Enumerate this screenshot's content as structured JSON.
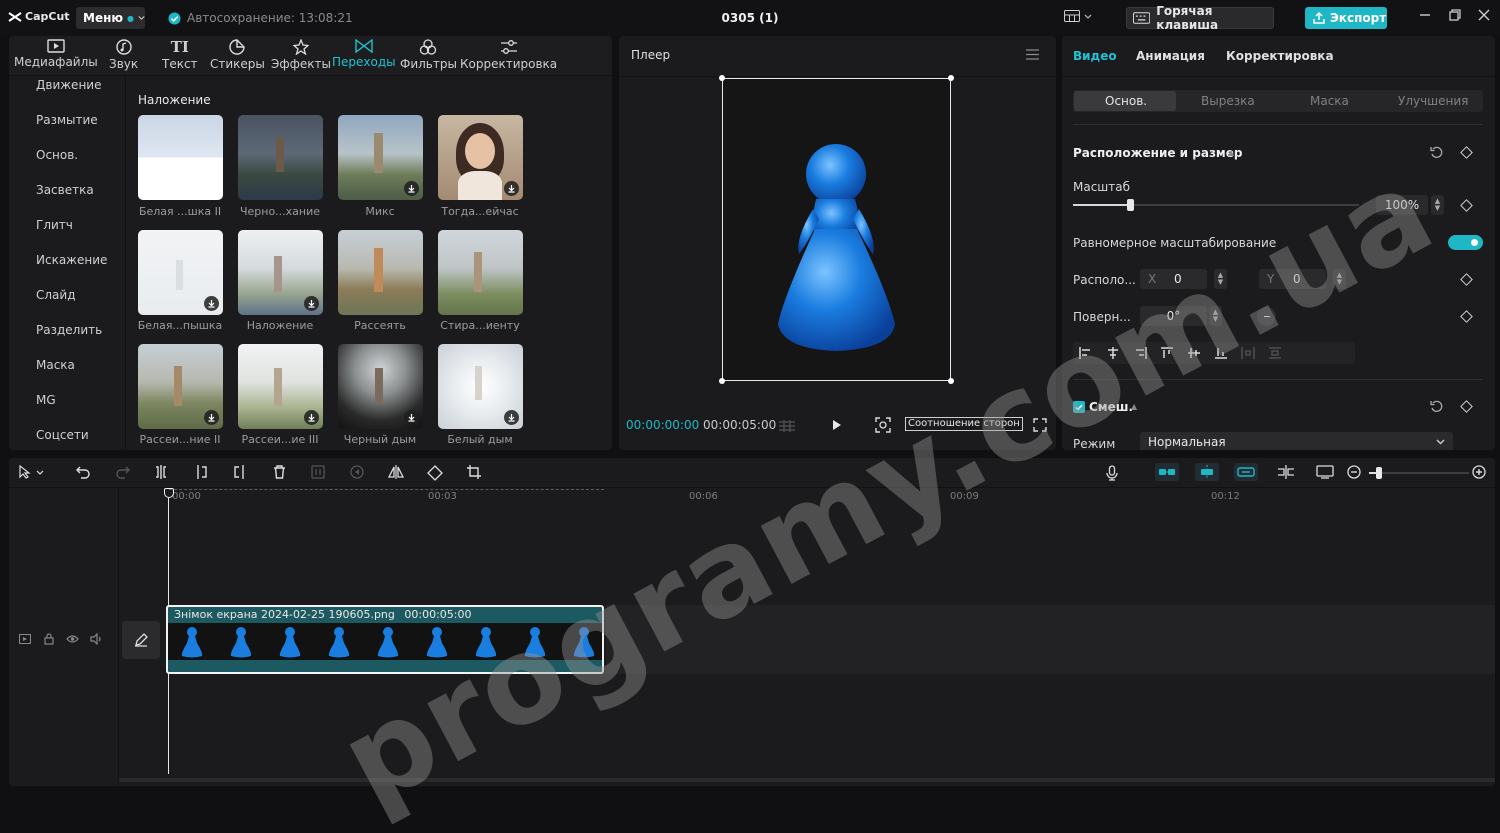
{
  "app": {
    "logo_text": "CapCut",
    "menu_label": "Меню",
    "autosave_text": "Автосохранение: 13:08:21",
    "project_title": "0305 (1)",
    "hotkey_label": "Горячая клавиша",
    "export_label": "Экспорт"
  },
  "media_toolbar": [
    {
      "label": "Медиафайлы",
      "icon": "media-icon"
    },
    {
      "label": "Звук",
      "icon": "audio-icon"
    },
    {
      "label": "Текст",
      "icon": "text-icon"
    },
    {
      "label": "Стикеры",
      "icon": "sticker-icon"
    },
    {
      "label": "Эффекты",
      "icon": "effects-icon"
    },
    {
      "label": "Переходы",
      "icon": "transitions-icon",
      "active": true
    },
    {
      "label": "Фильтры",
      "icon": "filters-icon"
    },
    {
      "label": "Корректировка",
      "icon": "adjust-icon"
    }
  ],
  "sidebar": [
    "Движение",
    "Размытие",
    "Основ.",
    "Засветка",
    "Глитч",
    "Искажение",
    "Слайд",
    "Разделить",
    "Маска",
    "MG",
    "Соцсети"
  ],
  "section_title": "Наложение",
  "transitions": [
    {
      "label": "Белая ...шка II",
      "download": false
    },
    {
      "label": "Черно...хание",
      "download": false
    },
    {
      "label": "Микс",
      "download": true
    },
    {
      "label": "Тогда...ейчас",
      "download": true
    },
    {
      "label": "Белая...пышка",
      "download": true
    },
    {
      "label": "Наложение",
      "download": true
    },
    {
      "label": "Рассеять",
      "download": false
    },
    {
      "label": "Стира...иенту",
      "download": false
    },
    {
      "label": "Рассеи...ние II",
      "download": true
    },
    {
      "label": "Рассеи...ие III",
      "download": true
    },
    {
      "label": "Черный дым",
      "download": true
    },
    {
      "label": "Белый дым",
      "download": true
    }
  ],
  "player": {
    "title": "Плеер",
    "current_time": "00:00:00:00",
    "total_time": "00:00:05:00",
    "ratio_label": "Соотношение сторон"
  },
  "inspector": {
    "tabs": [
      "Видео",
      "Анимация",
      "Корректировка"
    ],
    "subtabs": [
      "Основ.",
      "Вырезка",
      "Маска",
      "Улучшения"
    ],
    "position_size_title": "Расположение и размер",
    "scale_label": "Масштаб",
    "scale_value": "100%",
    "scale_fraction": 0.2,
    "uniform_scale_label": "Равномерное масштабирование",
    "uniform_scale_on": true,
    "position_label": "Располо...",
    "x_label": "X",
    "x_value": "0",
    "y_label": "Y",
    "y_value": "0",
    "rotation_label": "Поверн...",
    "rotation_value": "0°",
    "blend_title": "Смеш.",
    "mode_label": "Режим",
    "mode_value": "Нормальная"
  },
  "timeline": {
    "ruler": [
      "00:00",
      "00:03",
      "00:06",
      "00:09",
      "00:12"
    ],
    "clip_name": "Знімок екрана 2024-02-25 190605.png",
    "clip_duration": "00:00:05:00"
  },
  "watermark": "programy.com.ua",
  "colors": {
    "accent": "#1fb7c6",
    "clip_bg": "#1d5960",
    "figure_blue": "#1a7de0"
  }
}
